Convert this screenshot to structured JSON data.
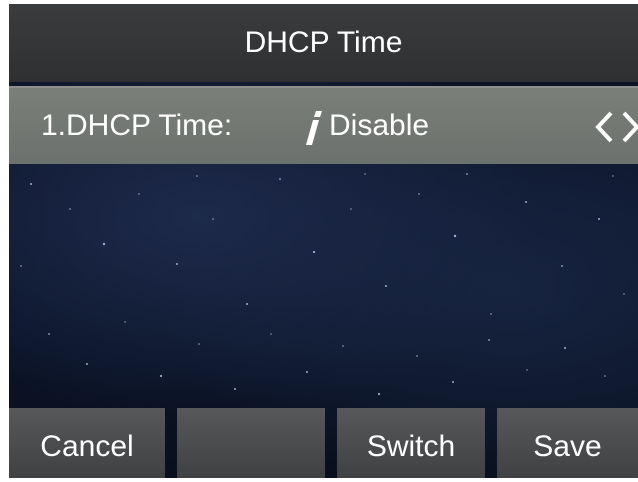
{
  "header": {
    "title": "DHCP Time"
  },
  "setting": {
    "label": "1.DHCP Time:",
    "value": "Disable",
    "input_icon": "i-cursor-icon",
    "arrows": [
      "arrow-left-icon",
      "arrow-right-icon"
    ]
  },
  "softkeys": {
    "key1": "Cancel",
    "key2": "",
    "key3": "Switch",
    "key4": "Save"
  },
  "colors": {
    "title_bar": "#333537",
    "setting_row": "#737873",
    "softkey": "#4a4c4e",
    "background": "#0e1730"
  }
}
